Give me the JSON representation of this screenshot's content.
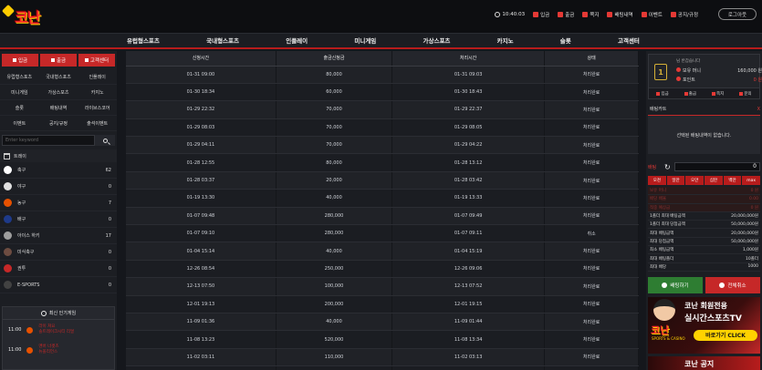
{
  "header": {
    "logo": "코난",
    "time": "10:40:03",
    "menu": [
      {
        "label": "입금",
        "icon": "deposit-icon"
      },
      {
        "label": "출금",
        "icon": "withdraw-icon"
      },
      {
        "label": "쪽지",
        "icon": "message-icon"
      },
      {
        "label": "배팅내역",
        "icon": "history-icon"
      },
      {
        "label": "이벤트",
        "icon": "event-icon"
      },
      {
        "label": "공지/규정",
        "icon": "notice-icon"
      }
    ],
    "login_label": "로그아웃"
  },
  "nav": [
    "유럽형스포츠",
    "국내형스포츠",
    "인플레이",
    "미니게임",
    "가상스포츠",
    "카지노",
    "슬롯",
    "고객센터"
  ],
  "sidebar": {
    "top_buttons": [
      "입금",
      "출금",
      "고객센터"
    ],
    "grid": [
      "유럽형스포츠",
      "국내형스포츠",
      "인플레이",
      "미니게임",
      "가상스포츠",
      "카지노",
      "슬롯",
      "배팅내역",
      "라이브스코어",
      "이벤트",
      "공지/규정",
      "출석이벤트"
    ],
    "search_placeholder": "Enter keyword",
    "today_label": "트레이",
    "sports": [
      {
        "name": "축구",
        "count": "62",
        "color": "#ffffff"
      },
      {
        "name": "야구",
        "count": "0",
        "color": "#e0e0e0"
      },
      {
        "name": "농구",
        "count": "7",
        "color": "#e65100"
      },
      {
        "name": "배구",
        "count": "0",
        "color": "#1e3a8a"
      },
      {
        "name": "아이스 하키",
        "count": "17",
        "color": "#9e9e9e"
      },
      {
        "name": "미식축구",
        "count": "0",
        "color": "#6d4c41"
      },
      {
        "name": "권투",
        "count": "0",
        "color": "#c62828"
      },
      {
        "name": "E-SPORTS",
        "count": "0",
        "color": "#424242"
      }
    ],
    "popular_title": "최신 인기게임",
    "popular": [
      {
        "time": "11:00",
        "line1": "라이 쳐요",
        "line2": "솔트레이크시티 리얼"
      },
      {
        "time": "11:00",
        "line1": "멘버 너겟츠",
        "line2": "뉴올리언스"
      }
    ]
  },
  "table": {
    "headers": [
      "신청시간",
      "출금신청금",
      "처리시간",
      "상태"
    ],
    "rows": [
      [
        "01-31 09:00",
        "80,000",
        "01-31 09:03",
        "처리완료"
      ],
      [
        "01-30 18:34",
        "60,000",
        "01-30 18:43",
        "처리완료"
      ],
      [
        "01-29 22:32",
        "70,000",
        "01-29 22:37",
        "처리완료"
      ],
      [
        "01-29 08:03",
        "70,000",
        "01-29 08:05",
        "처리완료"
      ],
      [
        "01-29 04:11",
        "70,000",
        "01-29 04:22",
        "처리완료"
      ],
      [
        "01-28 12:55",
        "80,000",
        "01-28 13:12",
        "처리완료"
      ],
      [
        "01-28 03:37",
        "20,000",
        "01-28 03:42",
        "처리완료"
      ],
      [
        "01-19 13:30",
        "40,000",
        "01-19 13:33",
        "처리완료"
      ],
      [
        "01-07 09:48",
        "280,000",
        "01-07 09:49",
        "처리완료"
      ],
      [
        "01-07 09:10",
        "280,000",
        "01-07 09:11",
        "취소"
      ],
      [
        "01-04 15:14",
        "40,000",
        "01-04 15:19",
        "처리완료"
      ],
      [
        "12-26 08:54",
        "250,000",
        "12-26 09:06",
        "처리완료"
      ],
      [
        "12-13 07:50",
        "100,000",
        "12-13 07:52",
        "처리완료"
      ],
      [
        "12-01 19:13",
        "200,000",
        "12-01 19:15",
        "처리완료"
      ],
      [
        "11-09 01:36",
        "40,000",
        "11-09 01:44",
        "처리완료"
      ],
      [
        "11-08 13:23",
        "520,000",
        "11-08 13:34",
        "처리완료"
      ],
      [
        "11-02 03:11",
        "110,000",
        "11-02 03:13",
        "처리완료"
      ],
      [
        "10-31 10:57",
        "120,000",
        "10-31 11:00",
        "처리완료"
      ]
    ]
  },
  "right": {
    "user_id": "님 반갑습니다",
    "level": "1",
    "money_label": "보유 머니",
    "money_value": "160,000 원",
    "point_label": "포인트",
    "point_value": "0 원",
    "card_buttons": [
      "입금",
      "출금",
      "쪽지",
      "문의"
    ],
    "cart_title": "배팅카트",
    "cart_clear": "X",
    "cart_empty": "선택된 배팅내역이 없습니다.",
    "amount_label": "배팅",
    "amount_value": "0",
    "quick": [
      "오천",
      "일만",
      "오만",
      "십만",
      "백만",
      "max"
    ],
    "info": [
      {
        "k": "보유 머니",
        "v": "0 원",
        "dim": true
      },
      {
        "k": "배당 배율",
        "v": "0.00",
        "dim": true
      },
      {
        "k": "적중 예상금",
        "v": "0 원",
        "dim": true
      },
      {
        "k": "1폴더 최대 배팅금액",
        "v": "20,000,000원",
        "dim": false
      },
      {
        "k": "1폴더 최대 당첨금액",
        "v": "50,000,000원",
        "dim": false
      },
      {
        "k": "최대 배팅금액",
        "v": "20,000,000원",
        "dim": false
      },
      {
        "k": "최대 당첨금액",
        "v": "50,000,000원",
        "dim": false
      },
      {
        "k": "최소 배팅금액",
        "v": "1,000원",
        "dim": false
      },
      {
        "k": "최대 배팅폴더",
        "v": "10폴더",
        "dim": false
      },
      {
        "k": "최대 배당",
        "v": "1000",
        "dim": false
      }
    ],
    "bet_btn": "배팅하기",
    "clear_btn": "전체취소",
    "banner_line1": "코난 회원전용",
    "banner_line2": "실시간스포츠TV",
    "banner_btn": "바로가기 CLICK",
    "banner_logo": "코난",
    "banner_sub": "SPORTS & CASINO",
    "banner2": "코난 공지"
  }
}
